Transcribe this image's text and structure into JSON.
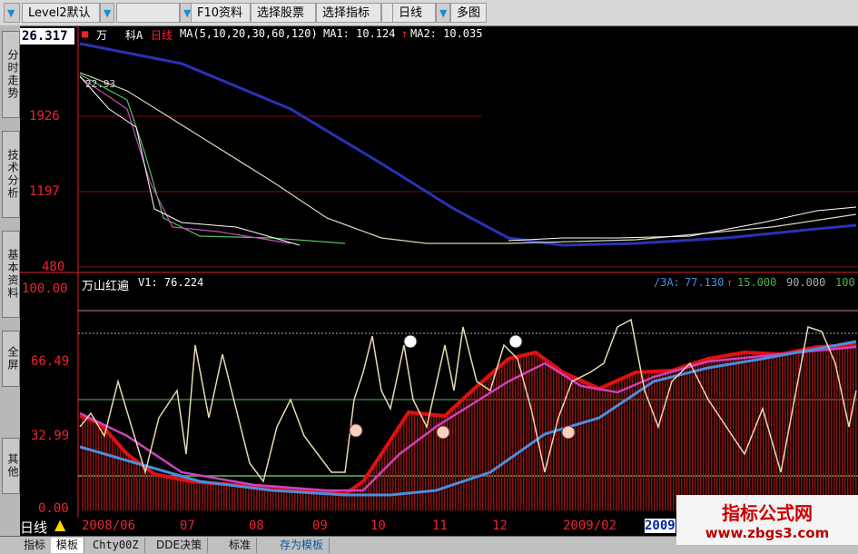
{
  "toolbar": {
    "items": [
      {
        "label": "Level2默认"
      },
      {
        "label": "F10资料"
      },
      {
        "label": "选择股票"
      },
      {
        "label": "选择指标"
      },
      {
        "label": "日线"
      },
      {
        "label": "多图"
      }
    ],
    "dropdown_glyph": "▼"
  },
  "sidebar": {
    "tabs": [
      "分时走势",
      "技术分析",
      "基本资料",
      "全屏",
      "其他"
    ]
  },
  "main_chart": {
    "current_price": "26.317",
    "title_marks": [
      "万",
      "科A",
      "日线"
    ],
    "ma_text": "MA(5,10,20,30,60,120)",
    "ma1_label": "MA1: 10.124",
    "ma2_label": "MA2: 10.035",
    "annotation": "22.93",
    "y_ticks": [
      "1926",
      "1197",
      "480"
    ]
  },
  "indicator": {
    "name": "万山红遍",
    "v1": "V1: 76.224",
    "right_prefix": "/3A:",
    "right_v1": "77.130",
    "right_v2": "15.000",
    "right_v3": "90.000",
    "right_v4": "100",
    "y_ticks": [
      "100.00",
      "66.49",
      "32.99",
      "0.00"
    ]
  },
  "x_axis": {
    "ticks": [
      "2008/06",
      "07",
      "08",
      "09",
      "10",
      "11",
      "12",
      "2009/02",
      "2009"
    ]
  },
  "period_label": "日线",
  "bottom_tabs": [
    "指标",
    "模板",
    "Chty00Z",
    "DDE决策",
    "标准",
    "存为模板"
  ],
  "watermark": {
    "title": "指标公式网",
    "url": "www.zbgs3.com"
  },
  "colors": {
    "background": "#000000",
    "axis_red": "#e0202a",
    "ma_blue": "#2a32b8",
    "bar_red": "#8b1212",
    "line_red": "#e01010",
    "line_magenta": "#d040c0",
    "line_blue": "#4a8ee0"
  }
}
